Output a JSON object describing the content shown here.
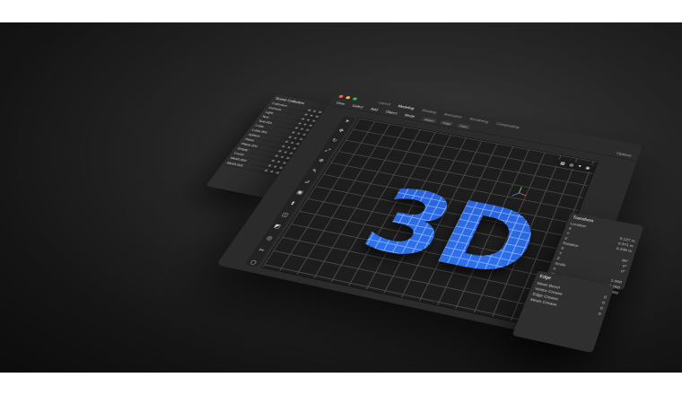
{
  "window": {
    "tabs": [
      "Layout",
      "Modeling",
      "Shading",
      "Animation",
      "Rendering",
      "Compositing"
    ],
    "active_tab": "Modeling",
    "menu": [
      "View",
      "Select",
      "Add",
      "Object",
      "Mode"
    ],
    "options_label": "Options",
    "sub_tools": [
      "Vertex",
      "Edge",
      "Face"
    ]
  },
  "viewport": {
    "text": "3D",
    "text_color": "#2f6be0",
    "grid": true,
    "view_tools": [
      "grid-icon",
      "globe-icon",
      "sphere-icon",
      "camera-icon"
    ]
  },
  "toolbar": {
    "icons": [
      "cursor-icon",
      "move-icon",
      "rotate-icon",
      "scale-icon",
      "transform-icon",
      "annotate-icon",
      "measure-icon",
      "add-cube-icon",
      "extrude-icon",
      "inset-icon",
      "bevel-icon",
      "loop-cut-icon",
      "knife-icon",
      "poly-build-icon"
    ]
  },
  "outliner": {
    "title": "Scene Collection",
    "items": [
      "Collection",
      "Camera",
      "Light",
      "Text",
      "Text.001",
      "Cube",
      "Cube.001",
      "Sphere",
      "Plane",
      "Plane.001",
      "Empty",
      "Curve",
      "Mesh.002",
      "Mesh.003"
    ]
  },
  "transform_panel": {
    "title": "Transform",
    "rows": [
      {
        "label": "Location",
        "value": ""
      },
      {
        "label": "X",
        "value": "0.127 m"
      },
      {
        "label": "Y",
        "value": "0.371 m"
      },
      {
        "label": "Z",
        "value": "0.239 m"
      },
      {
        "label": "Rotation",
        "value": ""
      },
      {
        "label": "X",
        "value": "90°"
      },
      {
        "label": "Y",
        "value": "0°"
      },
      {
        "label": "Z",
        "value": "0°"
      },
      {
        "label": "Scale",
        "value": ""
      },
      {
        "label": "X",
        "value": "1.000"
      },
      {
        "label": "Y",
        "value": "1.000"
      },
      {
        "label": "Z",
        "value": "1.000"
      }
    ]
  },
  "edge_panel": {
    "title": "Edge",
    "rows": [
      {
        "label": "Mean Bevel",
        "value": "0"
      },
      {
        "label": "Vertex Crease",
        "value": "0"
      },
      {
        "label": "Edge Crease",
        "value": "0"
      },
      {
        "label": "Mean Crease",
        "value": "0"
      }
    ]
  },
  "colors": {
    "background": "#141414",
    "window": "#2b2b2b",
    "accent": "#2f6be0",
    "dot_red": "#ff5f57",
    "dot_yellow": "#febc2e",
    "dot_green": "#28c840"
  }
}
